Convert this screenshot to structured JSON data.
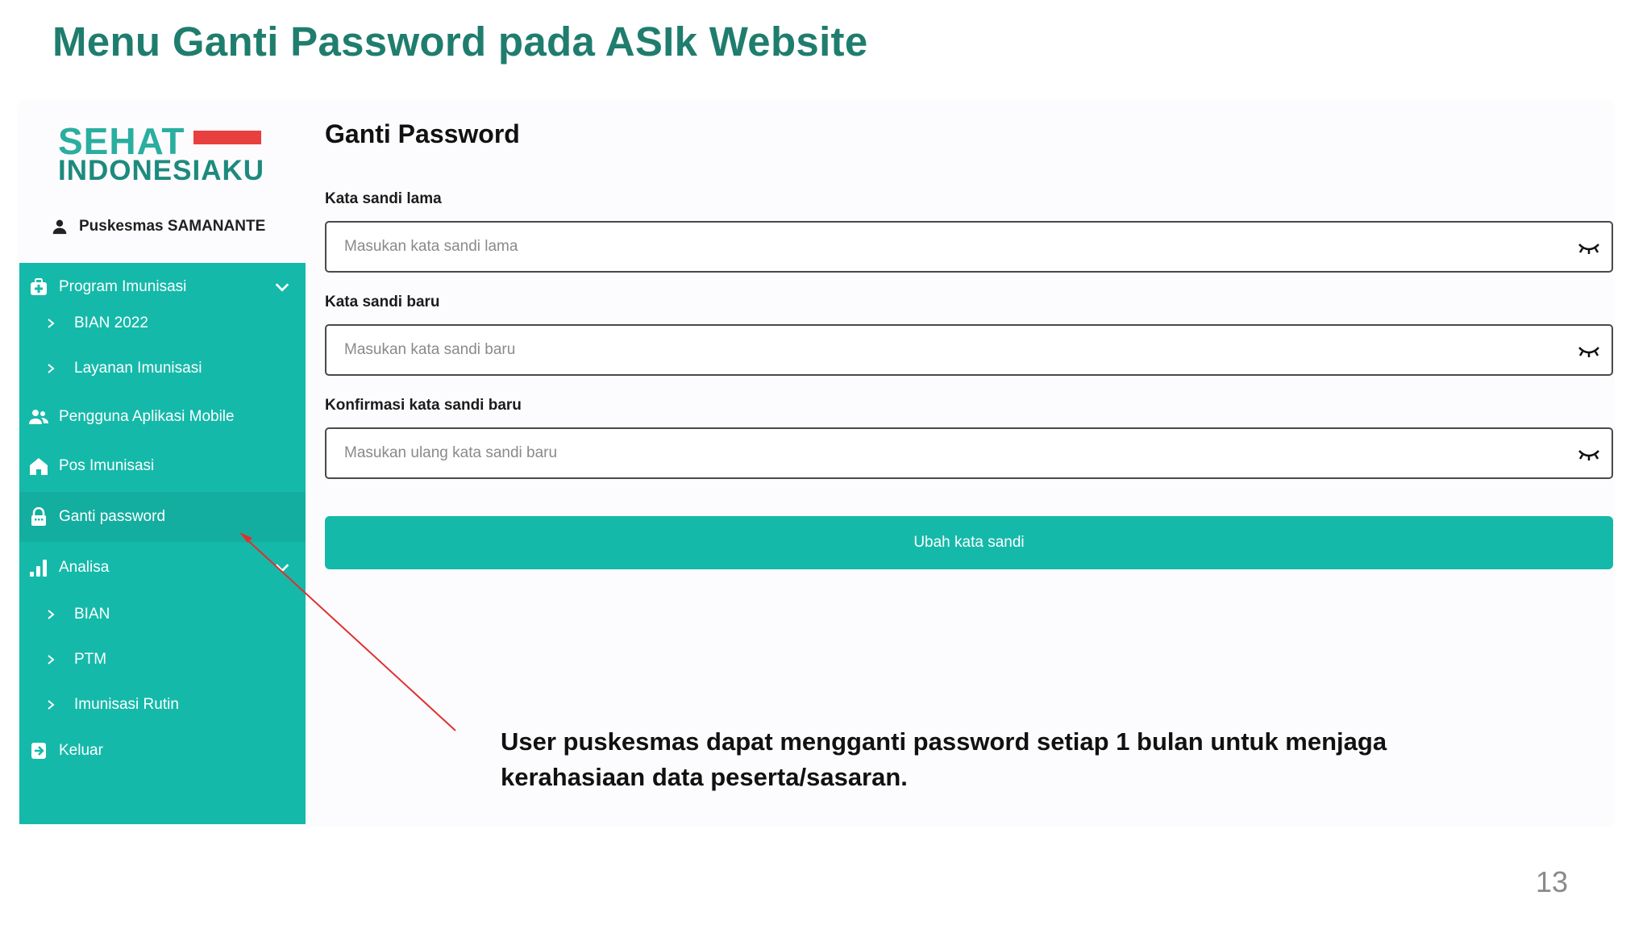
{
  "slide": {
    "title": "Menu Ganti Password pada ASIk Website",
    "note_line1": "User puskesmas dapat mengganti password setiap 1 bulan untuk menjaga",
    "note_line2": "kerahasiaan data peserta/sasaran.",
    "page_number": "13"
  },
  "logo": {
    "line1": "SEHAT",
    "line2": "INDONESIAKU"
  },
  "user": {
    "name": "Puskesmas SAMANANTE",
    "icon": "person-icon"
  },
  "sidebar": {
    "items": [
      {
        "label": "Program Imunisasi",
        "icon": "first-aid-kit-icon",
        "expandable": true
      },
      {
        "label": "BIAN 2022",
        "sub": true
      },
      {
        "label": "Layanan Imunisasi",
        "sub": true
      },
      {
        "label": "Pengguna Aplikasi Mobile",
        "icon": "users-icon"
      },
      {
        "label": "Pos Imunisasi",
        "icon": "home-icon"
      },
      {
        "label": "Ganti password",
        "icon": "lock-icon",
        "active": true
      },
      {
        "label": "Analisa",
        "icon": "bar-chart-icon",
        "expandable": true
      },
      {
        "label": "BIAN",
        "sub": true
      },
      {
        "label": "PTM",
        "sub": true
      },
      {
        "label": "Imunisasi Rutin",
        "sub": true
      },
      {
        "label": "Keluar",
        "icon": "logout-icon"
      }
    ]
  },
  "form": {
    "heading": "Ganti Password",
    "fields": [
      {
        "label": "Kata sandi lama",
        "placeholder": "Masukan kata sandi lama"
      },
      {
        "label": "Kata sandi baru",
        "placeholder": "Masukan kata sandi baru"
      },
      {
        "label": "Konfirmasi kata sandi baru",
        "placeholder": "Masukan ulang kata sandi baru"
      }
    ],
    "submit_label": "Ubah kata sandi"
  },
  "colors": {
    "title": "#1f7d6e",
    "sidebar": "#15b9a9",
    "logo_red": "#e8403e",
    "arrow": "#e0302e"
  }
}
